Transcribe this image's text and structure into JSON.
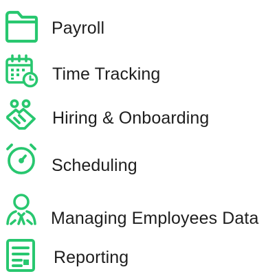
{
  "accent_color": "#28c76f",
  "text_color": "#1e1e1e",
  "features": [
    {
      "icon": "folder-icon",
      "label": "Payroll"
    },
    {
      "icon": "calendar-clock-icon",
      "label": "Time Tracking"
    },
    {
      "icon": "handshake-icon",
      "label": "Hiring & Onboarding"
    },
    {
      "icon": "alarm-clock-icon",
      "label": "Scheduling"
    },
    {
      "icon": "employee-icon",
      "label": "Managing Employees Data"
    },
    {
      "icon": "report-icon",
      "label": "Reporting"
    }
  ]
}
